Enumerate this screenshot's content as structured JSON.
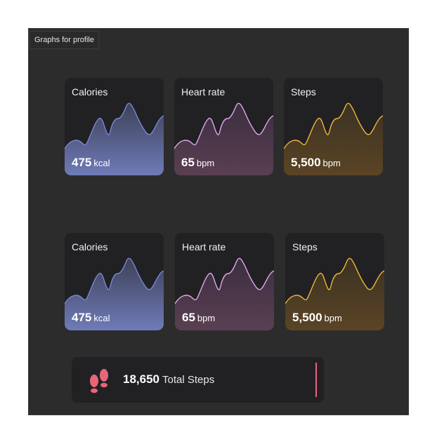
{
  "frame": {
    "label": "Graphs for profile"
  },
  "rows": [
    {
      "cards": [
        {
          "title": "Calories",
          "value": "475",
          "unit": "kcal",
          "color": "#7b86d6",
          "fill_top": "#3d4157",
          "fill_bottom": "#6f7bb8"
        },
        {
          "title": "Heart rate",
          "value": "65",
          "unit": "bpm",
          "color": "#e1a6f0",
          "fill_top": "#3b2f40",
          "fill_bottom": "#5a3f52"
        },
        {
          "title": "Steps",
          "value": "5,500",
          "unit": "bpm",
          "color": "#f1b43c",
          "fill_top": "#3a3223",
          "fill_bottom": "#5b4425"
        }
      ]
    },
    {
      "cards": [
        {
          "title": "Calories",
          "value": "475",
          "unit": "kcal",
          "color": "#7b86d6",
          "fill_top": "#3d4157",
          "fill_bottom": "#6f7bb8"
        },
        {
          "title": "Heart rate",
          "value": "65",
          "unit": "bpm",
          "color": "#e1a6f0",
          "fill_top": "#3b2f40",
          "fill_bottom": "#5a3f52"
        },
        {
          "title": "Steps",
          "value": "5,500",
          "unit": "bpm",
          "color": "#f1b43c",
          "fill_top": "#3a3223",
          "fill_bottom": "#5b4425"
        }
      ]
    }
  ],
  "steps_summary": {
    "value": "18,650",
    "label": "Total Steps",
    "icon": "footprints-icon",
    "accent": "#e8657a"
  }
}
